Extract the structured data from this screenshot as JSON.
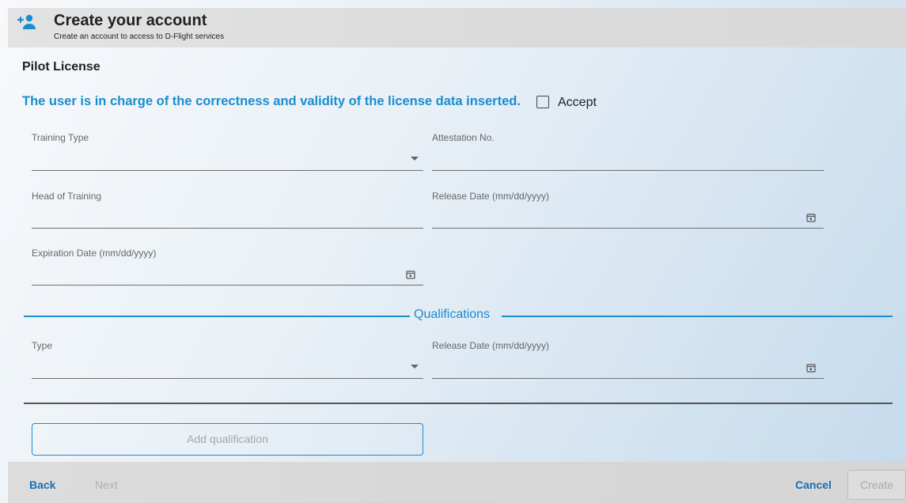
{
  "header": {
    "title": "Create your account",
    "subtitle": "Create an account to access to D-Flight services",
    "icon": "add-user-icon"
  },
  "section_title": "Pilot License",
  "notice": "The user is in charge of the correctness and validity of the license data inserted.",
  "accept": {
    "label": "Accept",
    "checked": false
  },
  "fields": {
    "training_type": {
      "label": "Training Type",
      "value": ""
    },
    "attestation_no": {
      "label": "Attestation No.",
      "value": ""
    },
    "head_of_training": {
      "label": "Head of Training",
      "value": ""
    },
    "release_date": {
      "label": "Release Date (mm/dd/yyyy)",
      "value": ""
    },
    "expiration_date": {
      "label": "Expiration Date (mm/dd/yyyy)",
      "value": ""
    }
  },
  "qualifications": {
    "title": "Qualifications",
    "type": {
      "label": "Type",
      "value": ""
    },
    "release_date": {
      "label": "Release Date (mm/dd/yyyy)",
      "value": ""
    },
    "add_button": "Add qualification"
  },
  "footer": {
    "back": "Back",
    "next": "Next",
    "cancel": "Cancel",
    "create": "Create"
  },
  "colors": {
    "accent": "#1a8dd0",
    "link": "#1a6fb0",
    "header_bg": "#e0e0e0"
  }
}
